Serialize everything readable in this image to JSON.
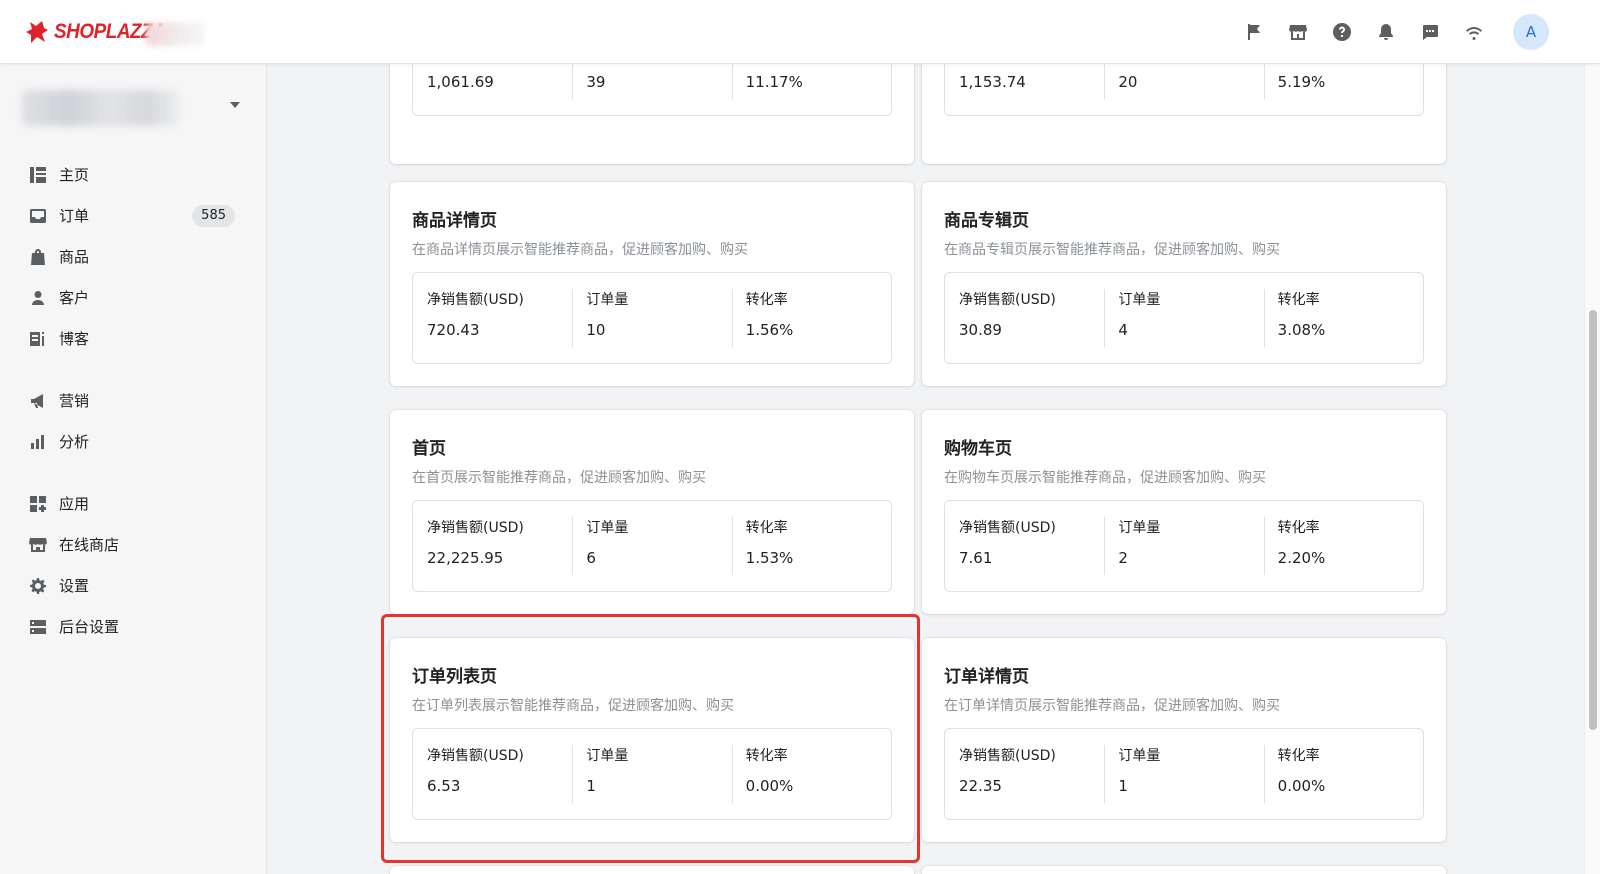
{
  "header": {
    "brand": "SHOPLAZZA",
    "avatar_letter": "A",
    "icons": [
      "flag-icon",
      "store-icon",
      "help-icon",
      "bell-icon",
      "chat-icon",
      "wifi-icon"
    ]
  },
  "sidebar": {
    "items": [
      {
        "label": "主页",
        "icon": "home-icon"
      },
      {
        "label": "订单",
        "icon": "orders-icon",
        "badge": "585"
      },
      {
        "label": "商品",
        "icon": "products-icon"
      },
      {
        "label": "客户",
        "icon": "customers-icon"
      },
      {
        "label": "博客",
        "icon": "blog-icon"
      },
      {
        "label": "营销",
        "icon": "marketing-icon"
      },
      {
        "label": "分析",
        "icon": "analytics-icon"
      },
      {
        "label": "应用",
        "icon": "apps-icon"
      },
      {
        "label": "在线商店",
        "icon": "online-store-icon"
      },
      {
        "label": "设置",
        "icon": "settings-icon"
      },
      {
        "label": "后台设置",
        "icon": "admin-settings-icon"
      }
    ]
  },
  "stat_labels": {
    "sales": "净销售额(USD)",
    "orders": "订单量",
    "conversion": "转化率"
  },
  "cards": [
    {
      "title": "",
      "desc": "",
      "sales": "1,061.69",
      "orders": "39",
      "conversion": "11.17%"
    },
    {
      "title": "",
      "desc": "",
      "sales": "1,153.74",
      "orders": "20",
      "conversion": "5.19%"
    },
    {
      "title": "商品详情页",
      "desc": "在商品详情页展示智能推荐商品，促进顾客加购、购买",
      "sales": "720.43",
      "orders": "10",
      "conversion": "1.56%"
    },
    {
      "title": "商品专辑页",
      "desc": "在商品专辑页展示智能推荐商品，促进顾客加购、购买",
      "sales": "30.89",
      "orders": "4",
      "conversion": "3.08%"
    },
    {
      "title": "首页",
      "desc": "在首页展示智能推荐商品，促进顾客加购、购买",
      "sales": "22,225.95",
      "orders": "6",
      "conversion": "1.53%"
    },
    {
      "title": "购物车页",
      "desc": "在购物车页展示智能推荐商品，促进顾客加购、购买",
      "sales": "7.61",
      "orders": "2",
      "conversion": "2.20%"
    },
    {
      "title": "订单列表页",
      "desc": "在订单列表展示智能推荐商品，促进顾客加购、购买",
      "sales": "6.53",
      "orders": "1",
      "conversion": "0.00%"
    },
    {
      "title": "订单详情页",
      "desc": "在订单详情页展示智能推荐商品，促进顾客加购、购买",
      "sales": "22.35",
      "orders": "1",
      "conversion": "0.00%"
    }
  ],
  "colors": {
    "brand": "#e0222a",
    "highlight": "#e5342e",
    "avatar_bg": "#d6e6fb"
  }
}
